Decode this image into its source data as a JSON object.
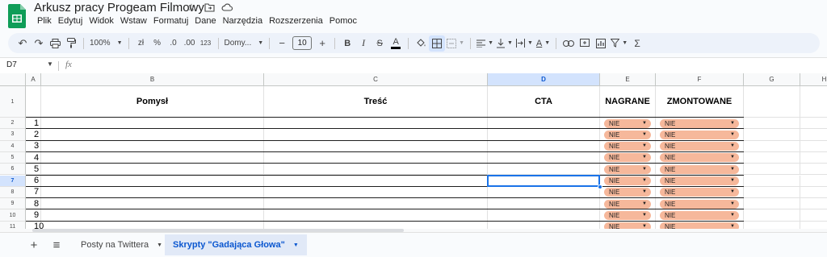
{
  "document": {
    "title": "Arkusz pracy Progeam Filmowy",
    "title_icons": [
      "star-icon",
      "move-to-folder-icon",
      "cloud-saved-icon"
    ]
  },
  "menu": [
    "Plik",
    "Edytuj",
    "Widok",
    "Wstaw",
    "Formatuj",
    "Dane",
    "Narzędzia",
    "Rozszerzenia",
    "Pomoc"
  ],
  "toolbar": {
    "undo": "↶",
    "redo": "↷",
    "zoom": "100%",
    "currency": "zł",
    "percent": "%",
    "decimal_decrease": ".0",
    "decimal_increase": ".00",
    "number_format": "123",
    "font": "Domy...",
    "font_size_minus": "−",
    "font_size": "10",
    "font_size_plus": "+",
    "bold": "B",
    "italic": "I",
    "strikethrough": "S",
    "text_color": "A",
    "function": "Σ"
  },
  "formula_bar": {
    "cell_ref": "D7",
    "fx": "fx",
    "value": ""
  },
  "grid": {
    "columns": [
      "A",
      "B",
      "C",
      "D",
      "E",
      "F",
      "G",
      "H"
    ],
    "selected_column": "D",
    "selected_row": "7",
    "header_row": {
      "row_number": "1",
      "A": "",
      "B": "Pomysł",
      "C": "Treść",
      "D": "CTA",
      "E": "NAGRANE",
      "F": "ZMONTOWANE"
    },
    "rows": [
      {
        "row_number": "2",
        "A": "1",
        "E": "NIE",
        "F": "NIE"
      },
      {
        "row_number": "3",
        "A": "2",
        "E": "NIE",
        "F": "NIE"
      },
      {
        "row_number": "4",
        "A": "3",
        "E": "NIE",
        "F": "NIE"
      },
      {
        "row_number": "5",
        "A": "4",
        "E": "NIE",
        "F": "NIE"
      },
      {
        "row_number": "6",
        "A": "5",
        "E": "NIE",
        "F": "NIE"
      },
      {
        "row_number": "7",
        "A": "6",
        "E": "NIE",
        "F": "NIE"
      },
      {
        "row_number": "8",
        "A": "7",
        "E": "NIE",
        "F": "NIE"
      },
      {
        "row_number": "9",
        "A": "8",
        "E": "NIE",
        "F": "NIE"
      },
      {
        "row_number": "10",
        "A": "9",
        "E": "NIE",
        "F": "NIE"
      },
      {
        "row_number": "11",
        "A": "10",
        "E": "NIE",
        "F": "NIE"
      }
    ],
    "chip_color": "#f6b89b",
    "selection_color": "#1a73e8"
  },
  "sheets": {
    "add": "+",
    "list": "≡",
    "tabs": [
      {
        "label": "Posty na Twittera",
        "active": false
      },
      {
        "label": "Skrypty \"Gadająca Głowa\"",
        "active": true
      }
    ]
  }
}
